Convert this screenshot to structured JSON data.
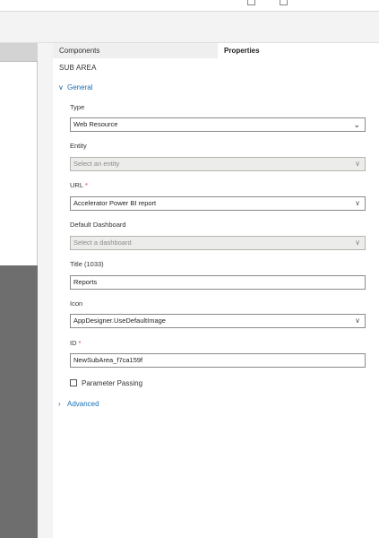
{
  "tabs": {
    "components": "Components",
    "properties": "Properties"
  },
  "section_title": "SUB AREA",
  "general": {
    "label": "General",
    "expanded": true
  },
  "advanced": {
    "label": "Advanced",
    "expanded": false
  },
  "fields": {
    "type": {
      "label": "Type",
      "value": "Web Resource"
    },
    "entity": {
      "label": "Entity",
      "placeholder": "Select an entity"
    },
    "url": {
      "label": "URL",
      "required_mark": "*",
      "value": "Accelerator Power BI report"
    },
    "default_dashboard": {
      "label": "Default Dashboard",
      "placeholder": "Select a dashboard"
    },
    "title": {
      "label": "Title (1033)",
      "value": "Reports"
    },
    "icon": {
      "label": "Icon",
      "value": "AppDesigner.UseDefaultImage"
    },
    "id": {
      "label": "ID",
      "required_mark": "*",
      "value": "NewSubArea_f7ca159f"
    },
    "parameter_passing": {
      "label": "Parameter Passing",
      "checked": false
    }
  },
  "icons": {
    "general_chevron": "chevron-down-icon",
    "advanced_chevron": "chevron-right-icon",
    "dropdown": "chevron-down-icon"
  },
  "colors": {
    "link": "#1a6fb5",
    "required": "#c0392b",
    "disabled_bg": "#ececea"
  }
}
